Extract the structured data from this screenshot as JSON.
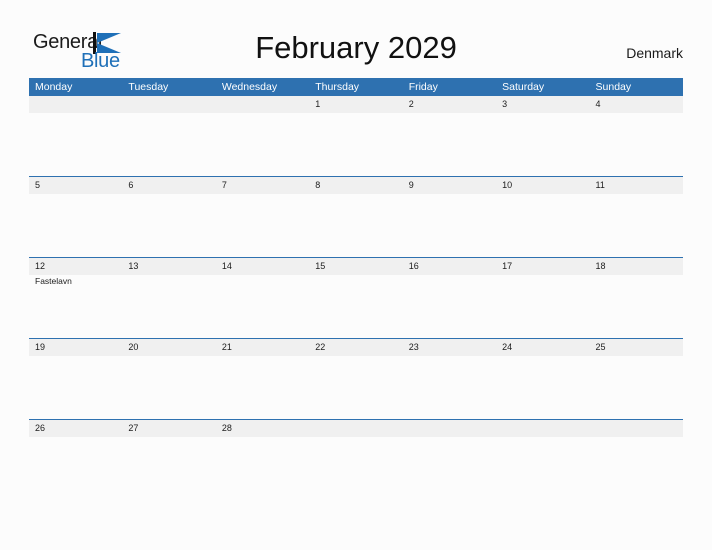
{
  "brand": {
    "name_part1": "General",
    "name_part2": "Blue",
    "logo_icon": "blue-triangle-flag-icon",
    "color_primary": "#1f70b8",
    "color_text": "#1b1b1b"
  },
  "header": {
    "title": "February 2029",
    "country": "Denmark"
  },
  "calendar": {
    "header_bg": "#2e71b0",
    "date_band_bg": "#f0f0f0",
    "row_border": "#2e71b0",
    "weekdays": [
      "Monday",
      "Tuesday",
      "Wednesday",
      "Thursday",
      "Friday",
      "Saturday",
      "Sunday"
    ],
    "weeks": [
      {
        "days": [
          {
            "date": "",
            "event": ""
          },
          {
            "date": "",
            "event": ""
          },
          {
            "date": "",
            "event": ""
          },
          {
            "date": "1",
            "event": ""
          },
          {
            "date": "2",
            "event": ""
          },
          {
            "date": "3",
            "event": ""
          },
          {
            "date": "4",
            "event": ""
          }
        ]
      },
      {
        "days": [
          {
            "date": "5",
            "event": ""
          },
          {
            "date": "6",
            "event": ""
          },
          {
            "date": "7",
            "event": ""
          },
          {
            "date": "8",
            "event": ""
          },
          {
            "date": "9",
            "event": ""
          },
          {
            "date": "10",
            "event": ""
          },
          {
            "date": "11",
            "event": ""
          }
        ]
      },
      {
        "days": [
          {
            "date": "12",
            "event": "Fastelavn"
          },
          {
            "date": "13",
            "event": ""
          },
          {
            "date": "14",
            "event": ""
          },
          {
            "date": "15",
            "event": ""
          },
          {
            "date": "16",
            "event": ""
          },
          {
            "date": "17",
            "event": ""
          },
          {
            "date": "18",
            "event": ""
          }
        ]
      },
      {
        "days": [
          {
            "date": "19",
            "event": ""
          },
          {
            "date": "20",
            "event": ""
          },
          {
            "date": "21",
            "event": ""
          },
          {
            "date": "22",
            "event": ""
          },
          {
            "date": "23",
            "event": ""
          },
          {
            "date": "24",
            "event": ""
          },
          {
            "date": "25",
            "event": ""
          }
        ]
      },
      {
        "days": [
          {
            "date": "26",
            "event": ""
          },
          {
            "date": "27",
            "event": ""
          },
          {
            "date": "28",
            "event": ""
          },
          {
            "date": "",
            "event": ""
          },
          {
            "date": "",
            "event": ""
          },
          {
            "date": "",
            "event": ""
          },
          {
            "date": "",
            "event": ""
          }
        ]
      }
    ]
  }
}
